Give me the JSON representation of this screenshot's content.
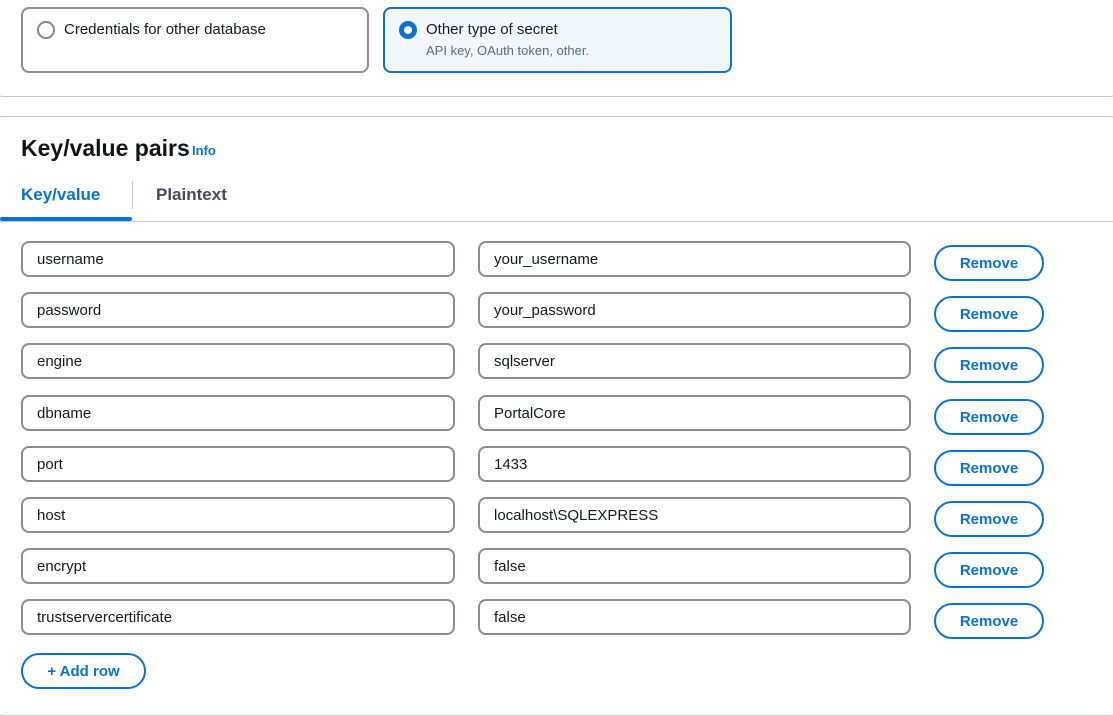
{
  "secret_type": {
    "options": [
      {
        "label": "Credentials for other database",
        "description": "",
        "selected": false
      },
      {
        "label": "Other type of secret",
        "description": "API key, OAuth token, other.",
        "selected": true
      }
    ]
  },
  "kv_section": {
    "title": "Key/value pairs",
    "info_label": "Info",
    "tabs": [
      {
        "label": "Key/value",
        "active": true
      },
      {
        "label": "Plaintext",
        "active": false
      }
    ],
    "rows": [
      {
        "key": "username",
        "value": "your_username",
        "remove_label": "Remove"
      },
      {
        "key": "password",
        "value": "your_password",
        "remove_label": "Remove"
      },
      {
        "key": "engine",
        "value": "sqlserver",
        "remove_label": "Remove"
      },
      {
        "key": "dbname",
        "value": "PortalCore",
        "remove_label": "Remove"
      },
      {
        "key": "port",
        "value": "1433",
        "remove_label": "Remove"
      },
      {
        "key": "host",
        "value": "localhost\\SQLEXPRESS",
        "remove_label": "Remove"
      },
      {
        "key": "encrypt",
        "value": "false",
        "remove_label": "Remove"
      },
      {
        "key": "trustservercertificate",
        "value": "false",
        "remove_label": "Remove"
      }
    ],
    "add_row_label": "+ Add row"
  },
  "colors": {
    "accent": "#0972d3",
    "border": "#8c8c94",
    "selected_bg": "#f2f8fd"
  }
}
